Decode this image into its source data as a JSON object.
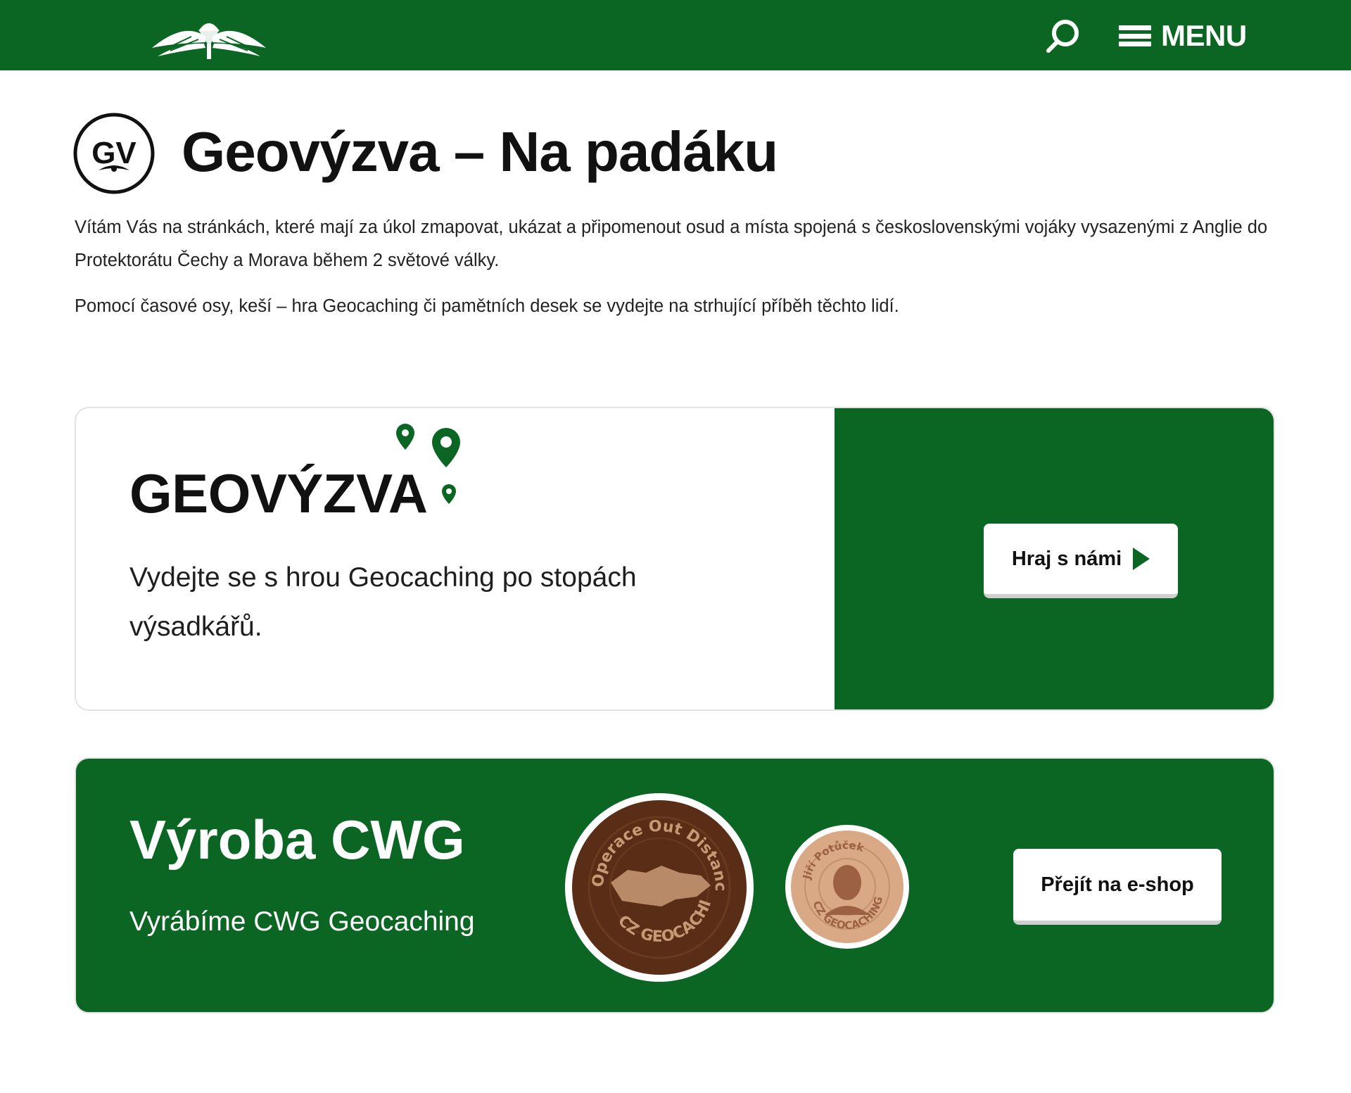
{
  "header": {
    "logo_icon": "parachute-wings-logo",
    "search_icon": "search-icon",
    "menu_icon": "hamburger-icon",
    "menu_label": "MENU"
  },
  "title_section": {
    "logo_icon": "gv-circle-logo",
    "logo_text": "GV",
    "title": "Geovýzva – Na padáku"
  },
  "intro": {
    "paragraph_1": "Vítám Vás na stránkách, které mají za úkol zmapovat, ukázat a připomenout osud a místa spojená s československými vojáky vysazenými z Anglie do Protektorátu Čechy a Morava během 2 světové války.",
    "paragraph_2": "Pomocí časové osy, keší – hra Geocaching či pamětních desek se vydejte na strhující příběh těchto lidí."
  },
  "geo_card": {
    "heading": "GEOVÝZVA",
    "pins_icon": "map-pins-icon",
    "text": "Vydejte se s hrou Geocaching po stopách výsadkářů.",
    "button_label": "Hraj s námi",
    "button_icon": "play-arrow-icon"
  },
  "cwg_card": {
    "heading": "Výroba CWG",
    "text": "Vyrábíme CWG Geocaching",
    "coin_big": {
      "top_text": "Operace Out Distance",
      "bottom_text": "CZ GEOCACHING"
    },
    "coin_small": {
      "top_text": "Jiří Potůček",
      "bottom_text": "CZ GEOCACHING"
    },
    "button_label": "Přejít na e-shop"
  },
  "colors": {
    "brand_green": "#0b6623",
    "white": "#ffffff",
    "text_dark": "#111111"
  }
}
